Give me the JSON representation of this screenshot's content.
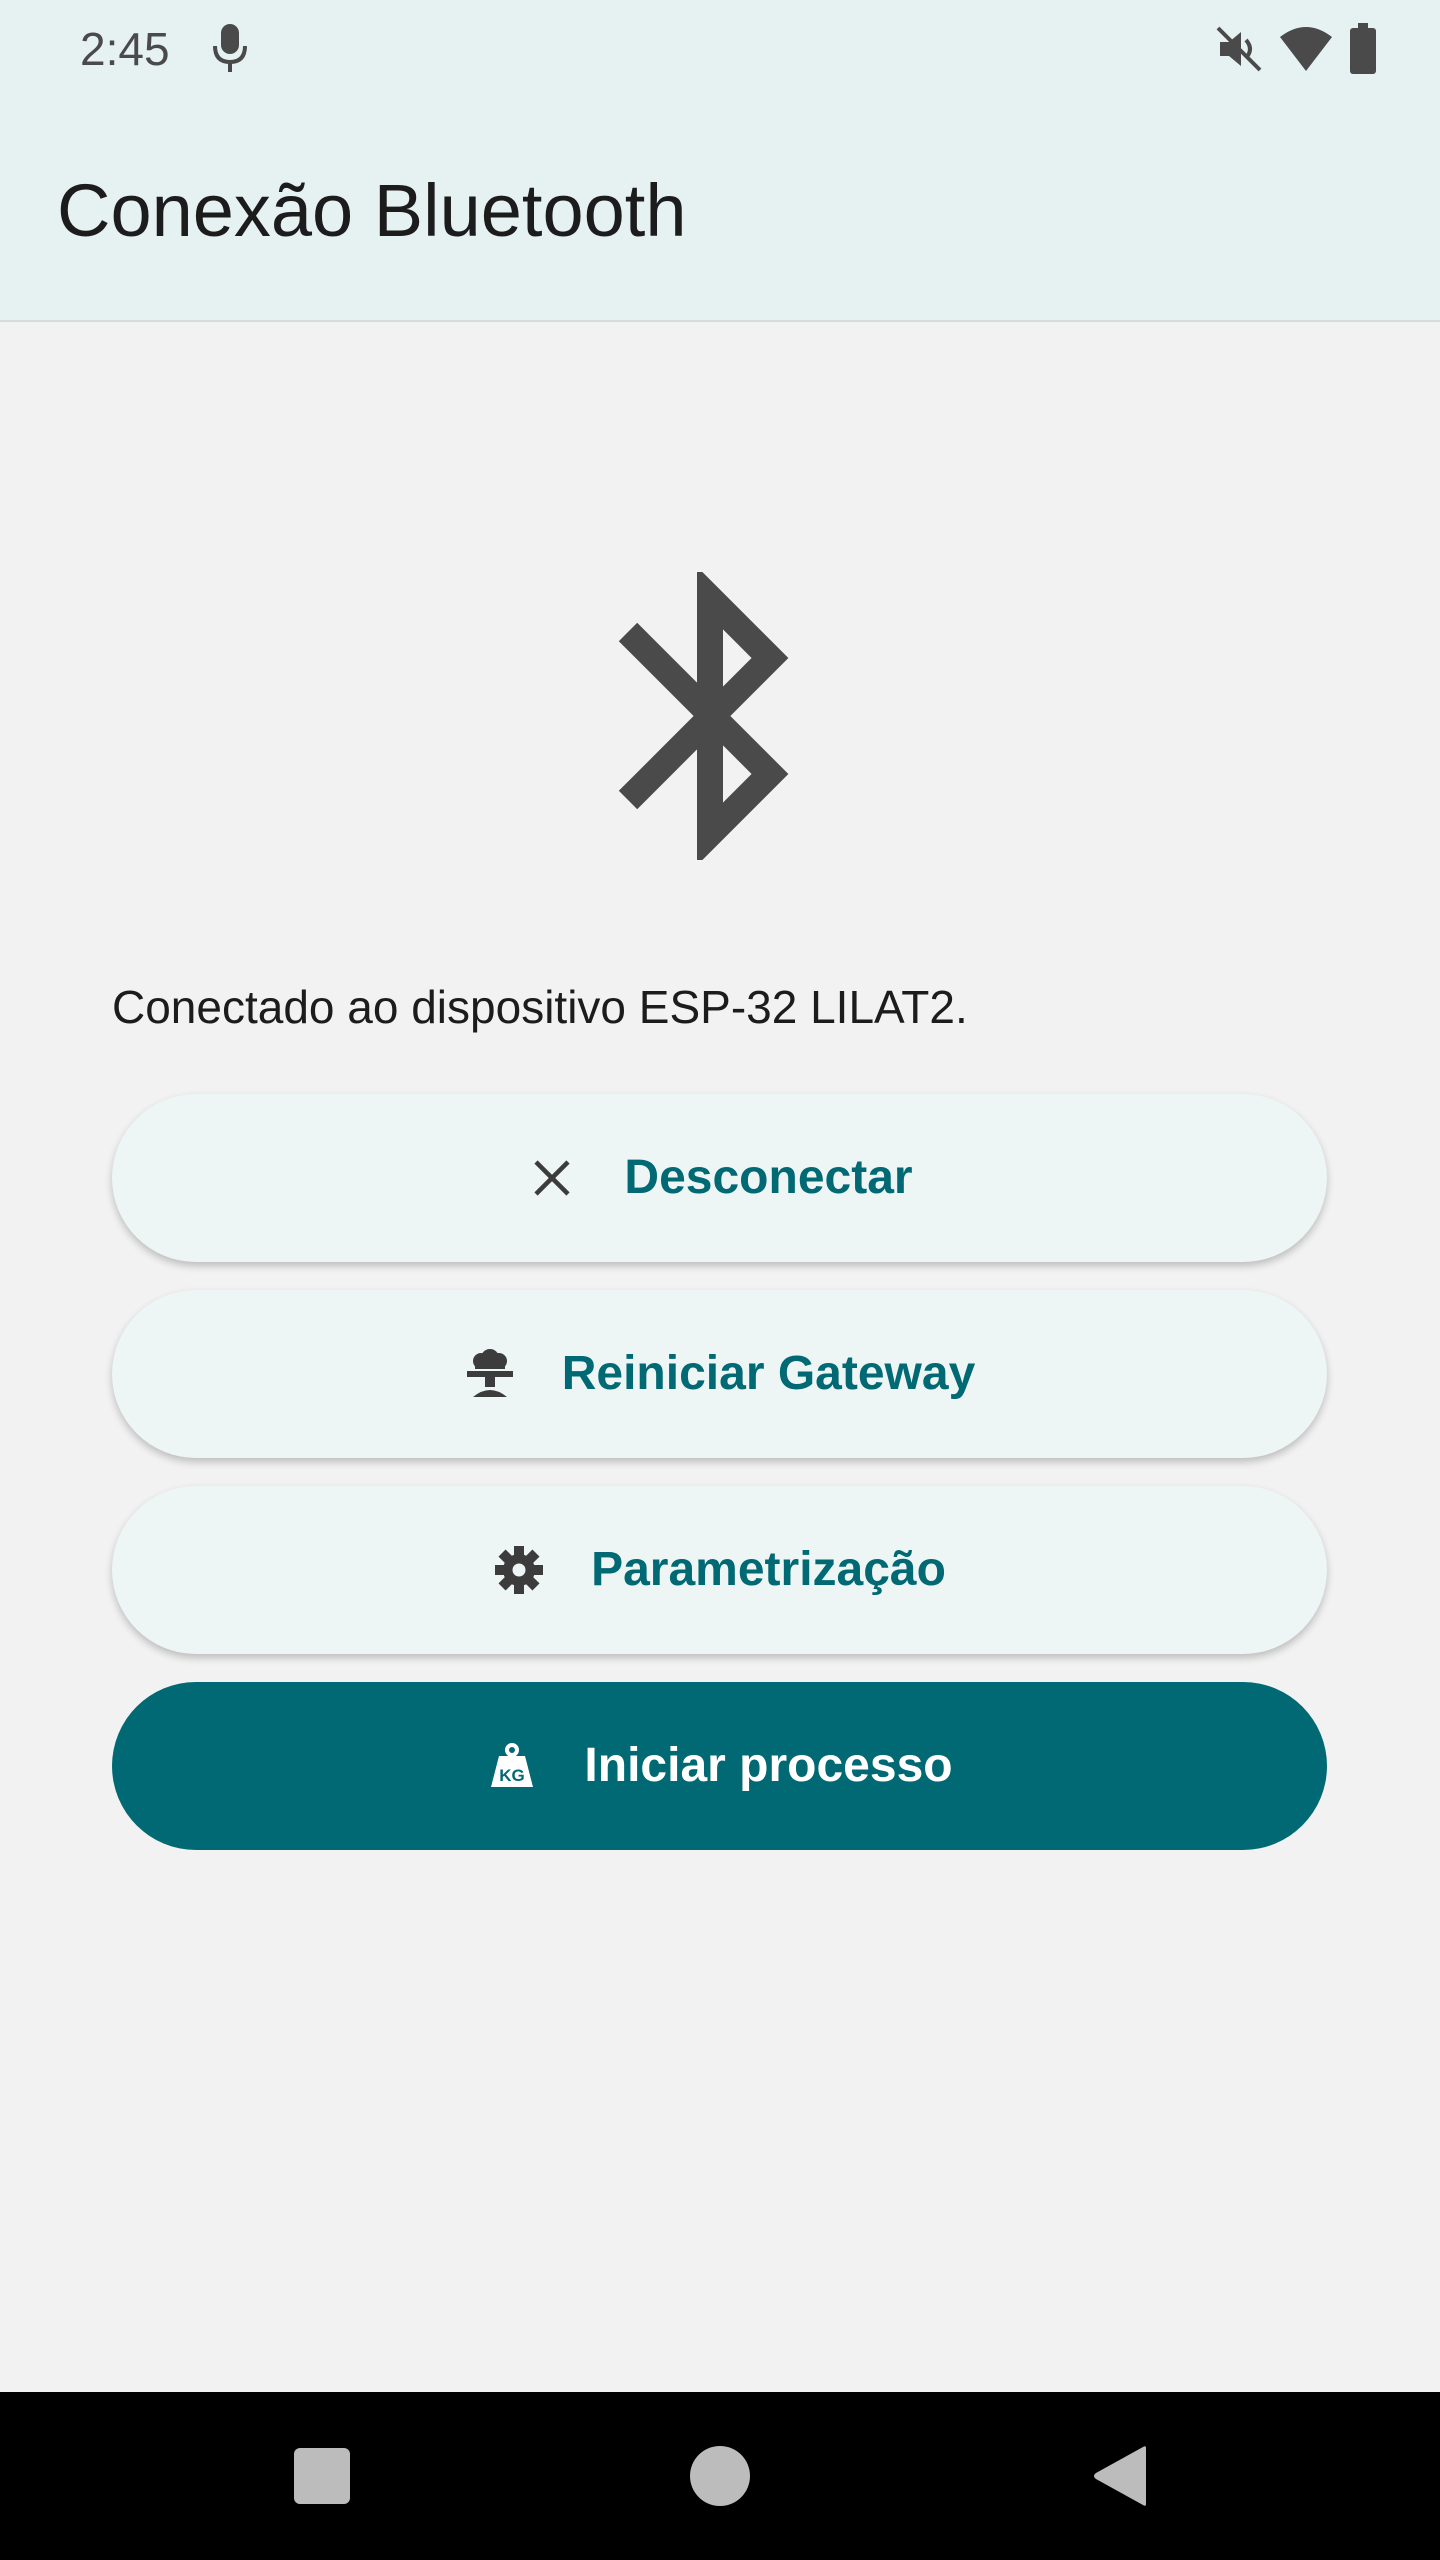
{
  "status_bar": {
    "time": "2:45",
    "icons": [
      "mic-icon",
      "mute-icon",
      "wifi-icon",
      "battery-icon"
    ]
  },
  "app_bar": {
    "title": "Conexão Bluetooth"
  },
  "main": {
    "hero_icon": "bluetooth-icon",
    "status_message": "Conectado ao dispositivo ESP-32 LILAT2.",
    "buttons": [
      {
        "label": "Desconectar",
        "icon": "close-icon"
      },
      {
        "label": "Reiniciar Gateway",
        "icon": "restart-icon"
      },
      {
        "label": "Parametrização",
        "icon": "gear-icon"
      },
      {
        "label": "Iniciar processo",
        "icon": "weight-kg-icon"
      }
    ]
  },
  "nav_bar": {
    "buttons": [
      "recents-icon",
      "home-icon",
      "back-icon"
    ]
  },
  "colors": {
    "accent": "#006973",
    "button_surface": "#edf5f5",
    "app_bar": "#e6f1f2",
    "background": "#f2f2f2",
    "icon": "#4a4a4a"
  }
}
